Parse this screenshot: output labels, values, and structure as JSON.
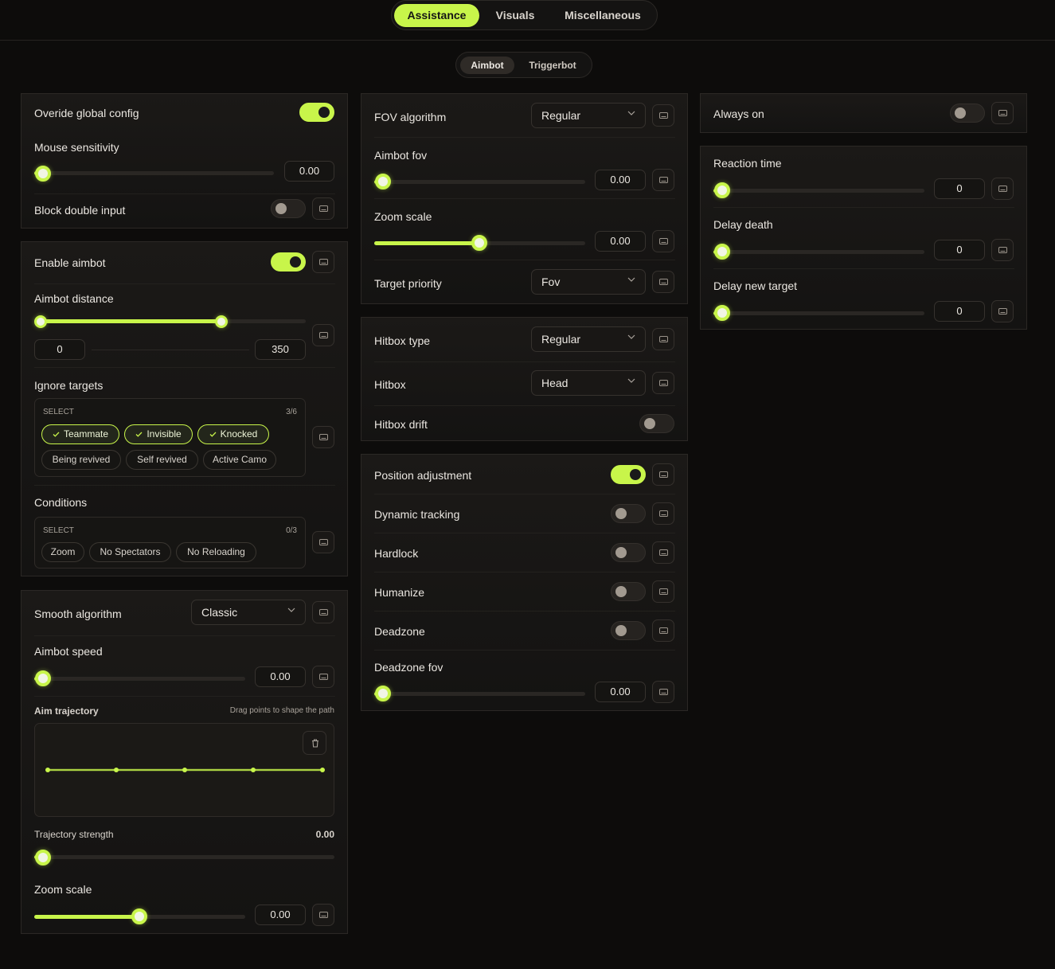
{
  "main_tabs": [
    "Assistance",
    "Visuals",
    "Miscellaneous"
  ],
  "sub_tabs": [
    "Aimbot",
    "Triggerbot"
  ],
  "accent_color": "#c8f54a",
  "icons": {
    "keybind": "keyboard-icon",
    "dropdown": "chevron-down-icon",
    "check": "check-icon",
    "delete": "trash-icon"
  },
  "col1": {
    "override_label": "Overide global config",
    "override_on": true,
    "mouse_sens_label": "Mouse sensitivity",
    "mouse_sens_value": "0.00",
    "block_double_label": "Block double input",
    "block_double_on": false,
    "enable_aimbot_label": "Enable aimbot",
    "enable_aimbot_on": true,
    "aimbot_distance_label": "Aimbot distance",
    "aimbot_distance_min": "0",
    "aimbot_distance_max": "350",
    "ignore_targets_label": "Ignore targets",
    "ignore_select_label": "SELECT",
    "ignore_count": "3/6",
    "ignore_chips": [
      "Teammate",
      "Invisible",
      "Knocked",
      "Being revived",
      "Self revived",
      "Active Camo"
    ],
    "conditions_label": "Conditions",
    "conditions_select_label": "SELECT",
    "conditions_count": "0/3",
    "conditions_chips": [
      "Zoom",
      "No Spectators",
      "No Reloading"
    ],
    "smooth_algo_label": "Smooth algorithm",
    "smooth_algo_value": "Classic",
    "aimbot_speed_label": "Aimbot speed",
    "aimbot_speed_value": "0.00",
    "aim_trajectory_label": "Aim trajectory",
    "aim_trajectory_hint": "Drag points to shape the path",
    "trajectory_strength_label": "Trajectory strength",
    "trajectory_strength_value": "0.00",
    "zoom_scale_label": "Zoom scale",
    "zoom_scale_value": "0.00"
  },
  "col2": {
    "fov_algo_label": "FOV algorithm",
    "fov_algo_value": "Regular",
    "aimbot_fov_label": "Aimbot fov",
    "aimbot_fov_value": "0.00",
    "zoom_scale_label": "Zoom scale",
    "zoom_scale_value": "0.00",
    "target_priority_label": "Target priority",
    "target_priority_value": "Fov",
    "hitbox_type_label": "Hitbox type",
    "hitbox_type_value": "Regular",
    "hitbox_label": "Hitbox",
    "hitbox_value": "Head",
    "hitbox_drift_label": "Hitbox drift",
    "hitbox_drift_on": false,
    "position_adj_label": "Position adjustment",
    "position_adj_on": true,
    "dynamic_tracking_label": "Dynamic tracking",
    "hardlock_label": "Hardlock",
    "humanize_label": "Humanize",
    "deadzone_label": "Deadzone",
    "deadzone_fov_label": "Deadzone fov",
    "deadzone_fov_value": "0.00"
  },
  "col3": {
    "always_on_label": "Always on",
    "always_on_on": false,
    "reaction_time_label": "Reaction time",
    "reaction_time_value": "0",
    "delay_death_label": "Delay death",
    "delay_death_value": "0",
    "delay_new_target_label": "Delay new target",
    "delay_new_target_value": "0"
  }
}
